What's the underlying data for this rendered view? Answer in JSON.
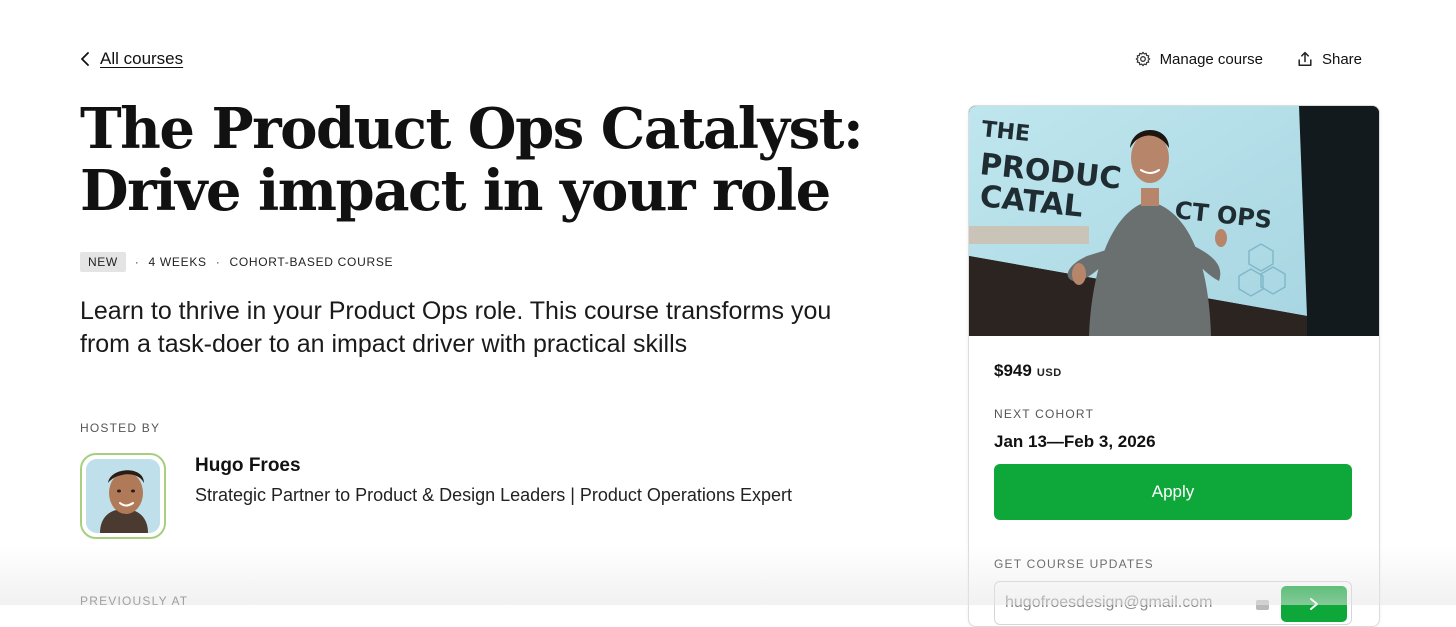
{
  "nav": {
    "back_label": "All courses",
    "manage_label": "Manage course",
    "share_label": "Share"
  },
  "course": {
    "title_line1": "The Product Ops Catalyst:",
    "title_line2": "Drive impact in your role",
    "badge": "NEW",
    "duration": "4 WEEKS",
    "format": "COHORT-BASED COURSE",
    "description": "Learn to thrive in your Product Ops role. This course transforms you from a task-doer to an impact driver with practical skills"
  },
  "host": {
    "section_label": "HOSTED BY",
    "name": "Hugo Froes",
    "title": "Strategic Partner to Product & Design Leaders | Product Operations Expert"
  },
  "previously": {
    "section_label": "PREVIOUSLY AT"
  },
  "card": {
    "image_text": [
      "THE",
      "PRODUC",
      "CATAL",
      "CT OPS"
    ],
    "price": "$949",
    "currency": "USD",
    "next_cohort_label": "NEXT COHORT",
    "cohort_dates": "Jan 13—Feb 3, 2026",
    "apply_label": "Apply",
    "updates_label": "GET COURSE UPDATES",
    "email_value": "hugofroesdesign@gmail.com"
  },
  "colors": {
    "accent_green": "#0ea73a",
    "avatar_border": "#a6cf7e",
    "badge_bg": "#e4e4e4"
  },
  "icons": {
    "back": "chevron-left-icon",
    "manage": "gear-icon",
    "share": "share-upload-icon",
    "submit": "arrow-right-icon"
  }
}
